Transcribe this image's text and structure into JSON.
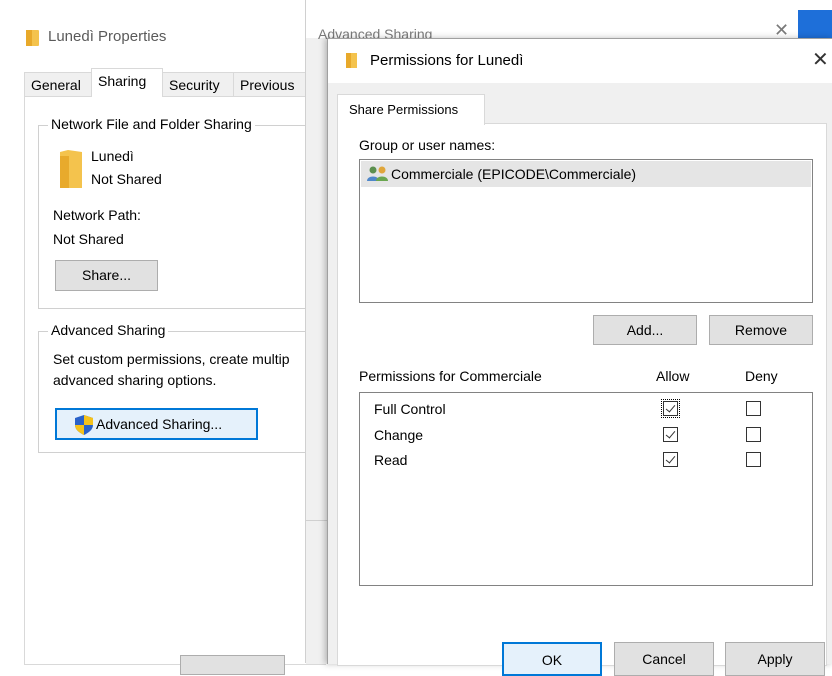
{
  "properties_window": {
    "title": "Lunedì Properties",
    "tabs": [
      {
        "label": "General"
      },
      {
        "label": "Sharing"
      },
      {
        "label": "Security"
      },
      {
        "label": "Previous"
      }
    ],
    "network_sharing": {
      "group_label": "Network File and Folder Sharing",
      "folder_name": "Lunedì",
      "folder_status": "Not Shared",
      "network_path_label": "Network Path:",
      "network_path_value": "Not Shared",
      "share_button": "Share..."
    },
    "advanced_sharing": {
      "group_label": "Advanced Sharing",
      "description_line1": "Set custom permissions, create multip",
      "description_line2": "advanced sharing options.",
      "button": "Advanced Sharing..."
    }
  },
  "advanced_sharing_window": {
    "title": "Advanced Sharing"
  },
  "permissions_dialog": {
    "title": "Permissions for Lunedì",
    "tab": "Share Permissions",
    "group_label": "Group or user names:",
    "users": [
      {
        "name": "Commerciale (EPICODE\\Commerciale)"
      }
    ],
    "add_button": "Add...",
    "remove_button": "Remove",
    "permissions_label": "Permissions for Commerciale",
    "allow_header": "Allow",
    "deny_header": "Deny",
    "permissions": [
      {
        "name": "Full Control",
        "allow": true,
        "deny": false
      },
      {
        "name": "Change",
        "allow": true,
        "deny": false
      },
      {
        "name": "Read",
        "allow": true,
        "deny": false
      }
    ],
    "ok_button": "OK",
    "cancel_button": "Cancel",
    "apply_button": "Apply"
  },
  "colors": {
    "selection": "#e5e5e5",
    "dialog_bg": "#f0f0f0",
    "accent_blue": "#0078d7"
  }
}
